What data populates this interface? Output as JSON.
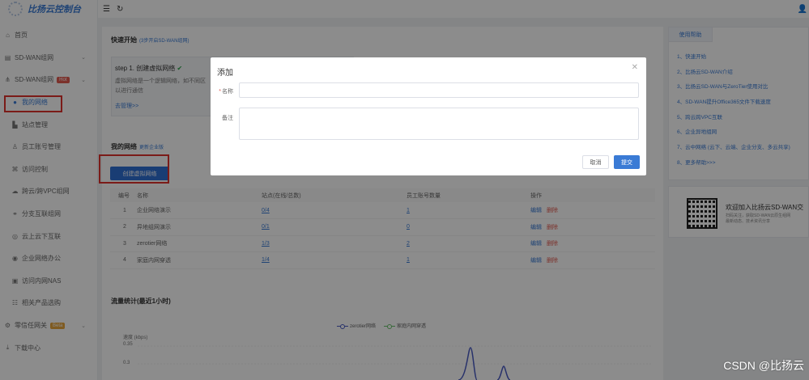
{
  "app": {
    "title": "比扬云控制台"
  },
  "sidebar": {
    "items": [
      {
        "label": "首页",
        "icon": "home-icon",
        "glyph": "⌂"
      },
      {
        "label": "SD-WAN组网",
        "icon": "network-icon",
        "glyph": "▤"
      },
      {
        "label": "SD-WAN组网",
        "icon": "share-icon",
        "glyph": "⋔",
        "badge": "Hot"
      },
      {
        "label": "我的网络",
        "icon": "dot-icon",
        "glyph": "●",
        "active": true
      },
      {
        "label": "站点管理",
        "icon": "site-icon",
        "glyph": "▙"
      },
      {
        "label": "员工账号管理",
        "icon": "user-icon",
        "glyph": "♙"
      },
      {
        "label": "访问控制",
        "icon": "control-icon",
        "glyph": "⌘"
      },
      {
        "label": "跨云/跨VPC组网",
        "icon": "cloud-icon",
        "glyph": "☁"
      },
      {
        "label": "分支互联组网",
        "icon": "link-icon",
        "glyph": "⚭"
      },
      {
        "label": "云上云下互联",
        "icon": "globe-icon",
        "glyph": "◎"
      },
      {
        "label": "企业网络办公",
        "icon": "office-icon",
        "glyph": "◉"
      },
      {
        "label": "访问内网NAS",
        "icon": "nas-icon",
        "glyph": "▣"
      },
      {
        "label": "相关产品选购",
        "icon": "shop-icon",
        "glyph": "☷"
      },
      {
        "label": "零信任网关",
        "icon": "gear-icon",
        "glyph": "⚙",
        "badge": "Beta"
      },
      {
        "label": "下载中心",
        "icon": "download-icon",
        "glyph": "⤓"
      }
    ]
  },
  "quick_start": {
    "title": "快速开始",
    "subtitle": "(3步开启SD-WAN组网)",
    "step_title": "step 1. 创建虚拟网络",
    "step_text_1": "虚拟网络是一个逻辑网络，如不同区",
    "step_text_2": "以进行通信",
    "step_link": "去管理>>"
  },
  "my_networks": {
    "title": "我的网络",
    "subtitle": "更新企业版",
    "create_label": "创建虚拟网络",
    "columns": [
      "编号",
      "名称",
      "站点(在线/总数)",
      "员工账号数量",
      "操作"
    ],
    "rows": [
      {
        "id": "1",
        "name": "企业网络演示",
        "sites": "0/4",
        "accounts": "1",
        "edit": "编辑",
        "del": "删除"
      },
      {
        "id": "2",
        "name": "异地组网演示",
        "sites": "0/1",
        "accounts": "0",
        "edit": "编辑",
        "del": "删除"
      },
      {
        "id": "3",
        "name": "zerotier网络",
        "sites": "1/3",
        "accounts": "2",
        "edit": "编辑",
        "del": "删除"
      },
      {
        "id": "4",
        "name": "家庭内网穿透",
        "sites": "1/4",
        "accounts": "1",
        "edit": "编辑",
        "del": "删除"
      }
    ]
  },
  "traffic": {
    "title": "流量统计(最近1小时)",
    "legend": [
      "zerotier网络",
      "家庭内网穿透"
    ],
    "y_unit": "速度 (kbps)",
    "y_ticks": [
      "0.35",
      "0.3"
    ],
    "colors": {
      "series1": "#4a5bc4",
      "series2": "#69c26a"
    }
  },
  "help": {
    "tab": "使用帮助",
    "items": [
      "1、快速开始",
      "2、比扬云SD-WAN介绍",
      "3、比扬云SD-WAN与ZeroTier使用对比",
      "4、SD-WAN提升Office365文件下载速度",
      "5、跨云跨VPC互联",
      "6、企业异地组网",
      "7、云中网络 (云下、云端、企业分支、多云共享)",
      "8、更多帮助>>>"
    ]
  },
  "promo": {
    "title": "欢迎加入比扬云SD-WAN交",
    "sub_1": "扫码关注，获取SD-WAN云原生组网",
    "sub_2": "最新动态、技术资讯分享"
  },
  "modal": {
    "title": "添加",
    "name_label": "名称",
    "name_value": "",
    "note_label": "备注",
    "note_value": "",
    "cancel": "取消",
    "submit": "提交"
  },
  "watermark": "CSDN @比扬云",
  "theme": {
    "accent": "#3a7bd5",
    "danger": "#e25a4f",
    "highlight_box": "#e0322c"
  }
}
